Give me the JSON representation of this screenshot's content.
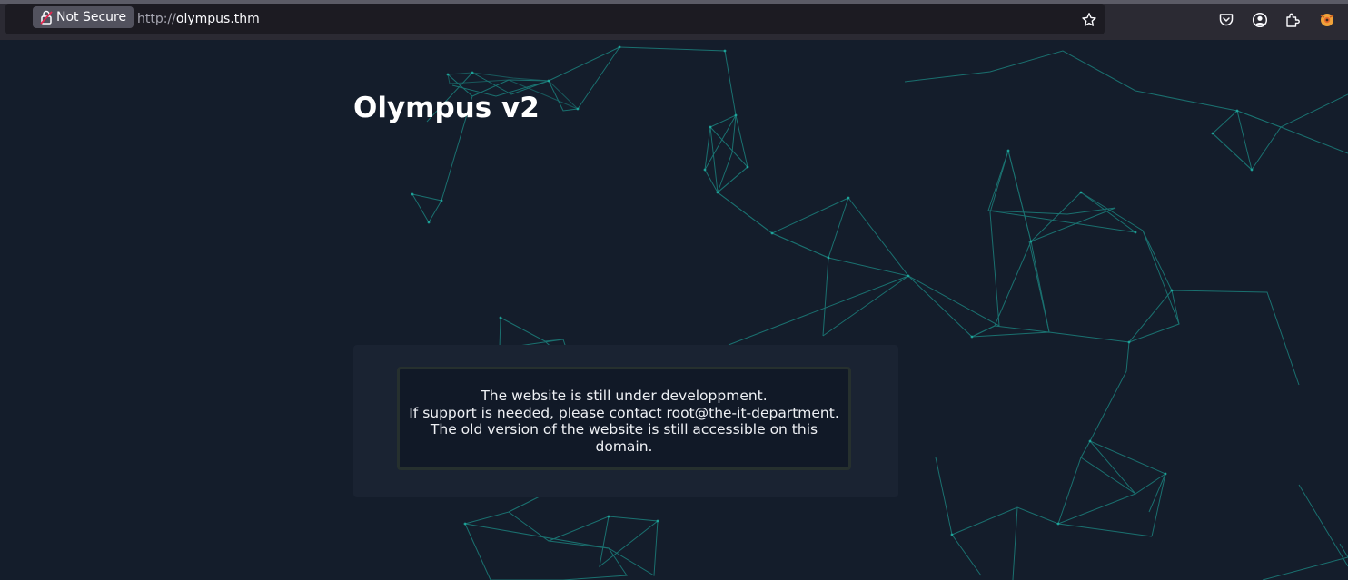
{
  "browser": {
    "security_label": "Not Secure",
    "url_protocol": "http://",
    "url_host": "olympus.thm",
    "icons": [
      "shield-icon",
      "lock-icon",
      "star-icon",
      "pocket-icon",
      "account-icon",
      "extensions-icon",
      "foxyproxy-icon"
    ]
  },
  "page": {
    "title": "Olympus v2",
    "notice_lines": [
      "The website is still under developpment.",
      "If support is needed, please contact root@the-it-department.",
      "The old version of the website is still accessible on this domain."
    ]
  },
  "colors": {
    "background": "#141d2b",
    "network_lines": "#1fb5a8",
    "panel": "#1a2332",
    "notice_box": "#111927"
  }
}
